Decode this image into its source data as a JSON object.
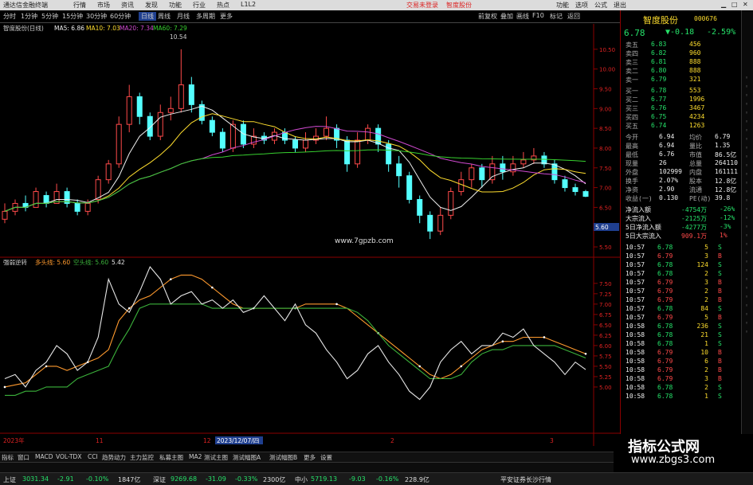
{
  "menubar": {
    "left": "通达信金融终端",
    "items": [
      "行情",
      "市场",
      "资讯",
      "发现",
      "功能",
      "行业",
      "热点",
      "L1L2"
    ],
    "login": "交易未登录",
    "stock_tag": "智度股份",
    "right": [
      "功能",
      "选项",
      "公式",
      "退出"
    ]
  },
  "toolbar": {
    "periods": [
      "分时",
      "1分钟",
      "5分钟",
      "15分钟",
      "30分钟",
      "60分钟",
      "日线",
      "周线",
      "月线",
      "多周期",
      "更多"
    ],
    "active": "日线",
    "right": [
      "前复权",
      "叠加",
      "画线",
      "F10",
      "标记",
      "返回"
    ]
  },
  "main_chart": {
    "header": "智度股份(日线)",
    "ma": [
      "MA5: 6.86",
      "MA10: 7.03",
      "MA20: 7.34",
      "MA60: 7.29"
    ],
    "high_label": "10.54",
    "watermark": "www.7gpzb.com",
    "price_flag": "5.60"
  },
  "sub_chart": {
    "header": "强弱逆转",
    "labels": [
      "多头线: 5.60",
      "空头线: 5.60",
      "5.42"
    ]
  },
  "xaxis": {
    "labels": [
      "2023年",
      "11",
      "12",
      "2023/12/07/四",
      "2",
      "3"
    ]
  },
  "right_panel": {
    "name": "智度股份",
    "code": "000676",
    "price": "6.78",
    "change": "▼-0.18",
    "change_pct": "-2.59%",
    "asks": [
      [
        "卖五",
        "6.83",
        "456"
      ],
      [
        "卖四",
        "6.82",
        "960"
      ],
      [
        "卖三",
        "6.81",
        "888"
      ],
      [
        "卖二",
        "6.80",
        "888"
      ],
      [
        "卖一",
        "6.79",
        "321"
      ]
    ],
    "bids": [
      [
        "买一",
        "6.78",
        "553"
      ],
      [
        "买二",
        "6.77",
        "1996"
      ],
      [
        "买三",
        "6.76",
        "3467"
      ],
      [
        "买四",
        "6.75",
        "4234"
      ],
      [
        "买五",
        "6.74",
        "1263"
      ]
    ],
    "stats": [
      [
        "今开",
        "6.94",
        "均价",
        "6.79"
      ],
      [
        "最高",
        "6.94",
        "量比",
        "1.35"
      ],
      [
        "最低",
        "6.76",
        "市值",
        "86.5亿"
      ],
      [
        "现量",
        "26",
        "总量",
        "264110"
      ],
      [
        "外盘",
        "102999",
        "内盘",
        "161111"
      ],
      [
        "换手",
        "2.07%",
        "股本",
        "12.8亿"
      ],
      [
        "净资",
        "2.90",
        "流通",
        "12.8亿"
      ],
      [
        "收益(一)",
        "0.130",
        "PE(动)",
        "39.8"
      ]
    ],
    "flows": [
      [
        "净流入额",
        "-4754万",
        "-26%"
      ],
      [
        "大宗流入",
        "-2125万",
        "-12%"
      ],
      [
        "5日净流入额",
        "-4277万",
        "-3%"
      ],
      [
        "5日大宗流入",
        "909.1万",
        "1%"
      ]
    ],
    "ticks": [
      [
        "10:57",
        "6.78",
        "5",
        "S"
      ],
      [
        "10:57",
        "6.79",
        "3",
        "B"
      ],
      [
        "10:57",
        "6.78",
        "124",
        "S"
      ],
      [
        "10:57",
        "6.78",
        "2",
        "S"
      ],
      [
        "10:57",
        "6.79",
        "3",
        "B"
      ],
      [
        "10:57",
        "6.79",
        "2",
        "B"
      ],
      [
        "10:57",
        "6.79",
        "2",
        "B"
      ],
      [
        "10:57",
        "6.78",
        "84",
        "S"
      ],
      [
        "10:57",
        "6.79",
        "5",
        "B"
      ],
      [
        "10:58",
        "6.78",
        "236",
        "S"
      ],
      [
        "10:58",
        "6.78",
        "21",
        "S"
      ],
      [
        "10:58",
        "6.78",
        "1",
        "S"
      ],
      [
        "10:58",
        "6.79",
        "10",
        "B"
      ],
      [
        "10:58",
        "6.79",
        "6",
        "B"
      ],
      [
        "10:58",
        "6.79",
        "2",
        "B"
      ],
      [
        "10:58",
        "6.79",
        "3",
        "B"
      ],
      [
        "10:58",
        "6.78",
        "2",
        "S"
      ],
      [
        "10:58",
        "6.78",
        "1",
        "S"
      ]
    ]
  },
  "bottom_tabs": [
    "指标",
    "窗口",
    "MACD",
    "VOL-TDX",
    "CCI",
    "趋势动力",
    "主力监控",
    "私募主图",
    "MA2",
    "测试主图",
    "测试幅图A",
    "测试幅图B",
    "更多",
    "设置"
  ],
  "status": {
    "items": [
      [
        "上证",
        "3031.34",
        "-2.91",
        "-0.10%",
        "1847亿"
      ],
      [
        "深证",
        "9269.68",
        "-31.09",
        "-0.33%",
        "2300亿"
      ],
      [
        "中小",
        "5719.13",
        "-9.03",
        "-0.16%",
        "228.9亿"
      ]
    ],
    "broker": "平安证券长沙行情"
  },
  "watermark": {
    "title": "指标公式网",
    "url": "www.zbgs3.com"
  },
  "chart_data": [
    {
      "type": "candlestick",
      "title": "智度股份(日线)",
      "ylim": [
        5.4,
        10.9
      ],
      "ticks": [
        "10.50",
        "10.00",
        "9.50",
        "9.00",
        "8.50",
        "8.00",
        "7.50",
        "7.00",
        "6.50",
        "6.00",
        "5.50"
      ],
      "series": [
        {
          "name": "MA5",
          "color": "#eeeeee"
        },
        {
          "name": "MA10",
          "color": "#ffde2e"
        },
        {
          "name": "MA20",
          "color": "#d04ad0"
        },
        {
          "name": "MA60",
          "color": "#37d02f"
        }
      ],
      "candles": [
        [
          6.2,
          6.4,
          6.6,
          6.1
        ],
        [
          6.4,
          6.6,
          6.7,
          6.3
        ],
        [
          6.6,
          6.5,
          6.8,
          6.4
        ],
        [
          6.5,
          6.9,
          7.0,
          6.5
        ],
        [
          6.8,
          6.6,
          6.9,
          6.5
        ],
        [
          6.6,
          6.9,
          7.1,
          6.6
        ],
        [
          6.9,
          6.6,
          7.0,
          6.5
        ],
        [
          6.6,
          6.4,
          6.7,
          6.3
        ],
        [
          6.4,
          6.6,
          6.7,
          6.3
        ],
        [
          6.7,
          7.2,
          7.3,
          6.6
        ],
        [
          7.2,
          7.6,
          7.7,
          7.1
        ],
        [
          7.6,
          8.6,
          8.8,
          7.5
        ],
        [
          8.6,
          9.3,
          9.6,
          8.4
        ],
        [
          9.3,
          8.8,
          9.4,
          8.6
        ],
        [
          8.8,
          8.3,
          8.9,
          8.2
        ],
        [
          8.3,
          8.9,
          9.1,
          8.2
        ],
        [
          8.9,
          9.0,
          9.3,
          8.7
        ],
        [
          9.0,
          9.6,
          10.5,
          8.9
        ],
        [
          9.6,
          9.1,
          9.8,
          8.9
        ],
        [
          9.1,
          8.7,
          9.2,
          8.6
        ],
        [
          8.7,
          8.4,
          8.8,
          8.3
        ],
        [
          8.4,
          8.0,
          8.5,
          7.9
        ],
        [
          8.0,
          8.6,
          8.7,
          7.9
        ],
        [
          8.6,
          8.1,
          8.7,
          8.0
        ],
        [
          8.1,
          8.3,
          8.5,
          8.0
        ],
        [
          8.3,
          8.2,
          8.4,
          8.1
        ],
        [
          8.2,
          8.4,
          8.5,
          8.1
        ],
        [
          8.4,
          8.2,
          8.5,
          8.1
        ],
        [
          8.2,
          8.0,
          8.3,
          7.9
        ],
        [
          8.0,
          8.2,
          8.4,
          7.9
        ],
        [
          8.2,
          8.3,
          8.5,
          8.1
        ],
        [
          8.3,
          8.5,
          8.8,
          8.2
        ],
        [
          8.5,
          8.2,
          8.6,
          8.0
        ],
        [
          8.2,
          7.6,
          8.3,
          7.4
        ],
        [
          7.6,
          8.2,
          8.4,
          7.5
        ],
        [
          8.2,
          8.5,
          8.6,
          8.1
        ],
        [
          8.5,
          8.1,
          8.6,
          7.9
        ],
        [
          8.1,
          7.6,
          8.2,
          7.4
        ],
        [
          7.6,
          7.3,
          7.8,
          7.0
        ],
        [
          7.3,
          6.7,
          7.4,
          6.6
        ],
        [
          6.7,
          6.3,
          6.8,
          6.1
        ],
        [
          6.3,
          5.9,
          6.4,
          5.7
        ],
        [
          5.9,
          6.3,
          6.5,
          5.8
        ],
        [
          6.3,
          6.9,
          7.0,
          6.2
        ],
        [
          6.9,
          7.2,
          7.4,
          6.8
        ],
        [
          7.2,
          7.5,
          7.6,
          7.0
        ],
        [
          7.5,
          7.2,
          7.6,
          7.0
        ],
        [
          7.2,
          7.6,
          7.8,
          7.1
        ],
        [
          7.6,
          7.4,
          7.8,
          7.2
        ],
        [
          7.4,
          7.6,
          7.8,
          7.3
        ],
        [
          7.6,
          7.7,
          7.9,
          7.5
        ],
        [
          7.7,
          7.8,
          8.0,
          7.6
        ],
        [
          7.8,
          7.6,
          7.9,
          7.5
        ],
        [
          7.6,
          7.2,
          7.7,
          7.1
        ],
        [
          7.2,
          7.0,
          7.3,
          6.9
        ],
        [
          7.0,
          6.9,
          7.1,
          6.8
        ],
        [
          6.9,
          6.78,
          6.94,
          6.76
        ]
      ]
    },
    {
      "type": "line",
      "title": "强弱逆转",
      "ylim": [
        4.0,
        7.9
      ],
      "ticks": [
        "7.50",
        "7.25",
        "7.00",
        "6.75",
        "6.50",
        "6.25",
        "6.00",
        "5.75",
        "5.50",
        "5.25",
        "5.00"
      ],
      "series": [
        {
          "name": "多头线",
          "color": "#ff9a2e",
          "values": [
            5.0,
            5.05,
            5.1,
            5.3,
            5.5,
            5.5,
            5.4,
            5.5,
            5.6,
            5.7,
            5.9,
            6.6,
            6.9,
            7.1,
            7.2,
            7.4,
            7.6,
            7.7,
            7.7,
            7.6,
            7.4,
            7.2,
            7.0,
            6.9,
            6.9,
            6.9,
            6.9,
            6.9,
            6.9,
            7.0,
            7.0,
            7.0,
            7.0,
            6.9,
            6.7,
            6.5,
            6.3,
            6.1,
            5.9,
            5.7,
            5.5,
            5.3,
            5.2,
            5.3,
            5.5,
            5.7,
            5.9,
            6.0,
            6.1,
            6.1,
            6.2,
            6.2,
            6.2,
            6.1,
            6.0,
            5.9,
            5.8
          ]
        },
        {
          "name": "空头线",
          "color": "#3bb23b",
          "values": [
            4.8,
            4.8,
            4.9,
            4.9,
            5.0,
            5.0,
            5.0,
            5.2,
            5.3,
            5.4,
            5.5,
            6.0,
            6.4,
            6.9,
            7.0,
            7.0,
            7.0,
            7.0,
            7.0,
            7.0,
            6.9,
            6.9,
            6.9,
            6.9,
            6.9,
            6.9,
            6.9,
            6.9,
            6.9,
            6.9,
            6.9,
            6.9,
            6.9,
            6.9,
            6.8,
            6.6,
            6.3,
            6.0,
            5.8,
            5.6,
            5.4,
            5.2,
            5.2,
            5.2,
            5.3,
            5.6,
            5.8,
            5.9,
            5.9,
            6.0,
            6.0,
            6.0,
            6.0,
            6.0,
            5.9,
            5.8,
            5.7
          ]
        },
        {
          "name": "5.42",
          "color": "#e6e6e6",
          "values": [
            5.2,
            5.3,
            5.0,
            5.4,
            5.6,
            6.0,
            5.8,
            5.4,
            5.6,
            6.2,
            7.6,
            7.0,
            6.8,
            7.3,
            7.9,
            7.6,
            7.0,
            7.2,
            7.3,
            7.0,
            7.1,
            6.9,
            7.1,
            6.8,
            6.9,
            7.2,
            6.9,
            6.6,
            7.0,
            6.5,
            6.3,
            5.9,
            5.6,
            5.2,
            5.4,
            5.8,
            6.0,
            5.6,
            5.3,
            4.9,
            4.7,
            5.0,
            5.6,
            5.9,
            6.1,
            5.8,
            6.0,
            6.0,
            6.3,
            6.2,
            6.4,
            6.0,
            5.8,
            5.6,
            5.3,
            5.6,
            5.42
          ]
        }
      ]
    }
  ]
}
